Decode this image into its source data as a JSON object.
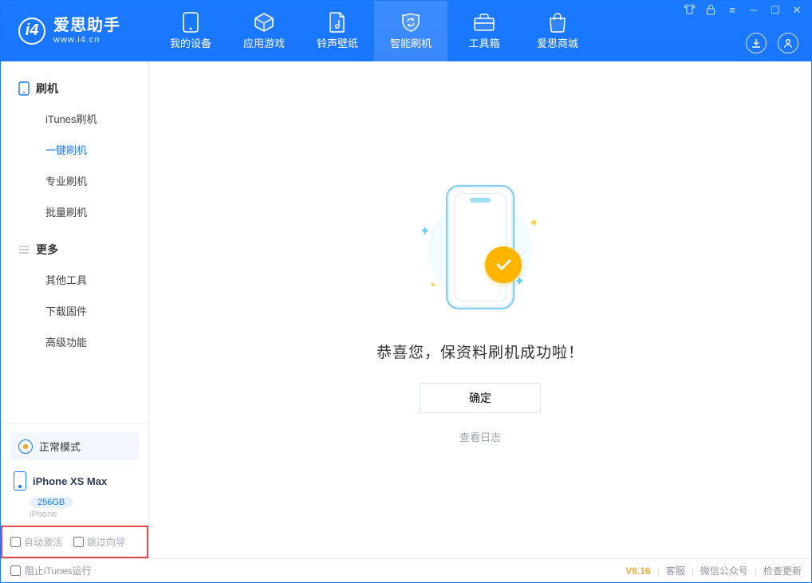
{
  "logo": {
    "title": "爱思助手",
    "url": "www.i4.cn"
  },
  "nav": [
    {
      "label": "我的设备",
      "icon": "device"
    },
    {
      "label": "应用游戏",
      "icon": "apps"
    },
    {
      "label": "铃声壁纸",
      "icon": "ring"
    },
    {
      "label": "智能刷机",
      "icon": "flash"
    },
    {
      "label": "工具箱",
      "icon": "tools"
    },
    {
      "label": "爱思商城",
      "icon": "store"
    }
  ],
  "sidebar": {
    "groups": [
      {
        "title": "刷机",
        "items": [
          "iTunes刷机",
          "一键刷机",
          "专业刷机",
          "批量刷机"
        ],
        "active_index": 1
      },
      {
        "title": "更多",
        "items": [
          "其他工具",
          "下载固件",
          "高级功能"
        ]
      }
    ],
    "mode_label": "正常模式",
    "device": {
      "name": "iPhone XS Max",
      "storage": "256GB",
      "subtitle": "iPhone"
    },
    "checks": {
      "auto_activate": "自动激活",
      "skip_guide": "跳过向导"
    }
  },
  "main": {
    "success_message": "恭喜您，保资料刷机成功啦！",
    "ok_button": "确定",
    "view_log": "查看日志"
  },
  "footer": {
    "prevent_itunes": "阻止iTunes运行",
    "version": "V8.16",
    "links": [
      "客服",
      "微信公众号",
      "检查更新"
    ]
  }
}
